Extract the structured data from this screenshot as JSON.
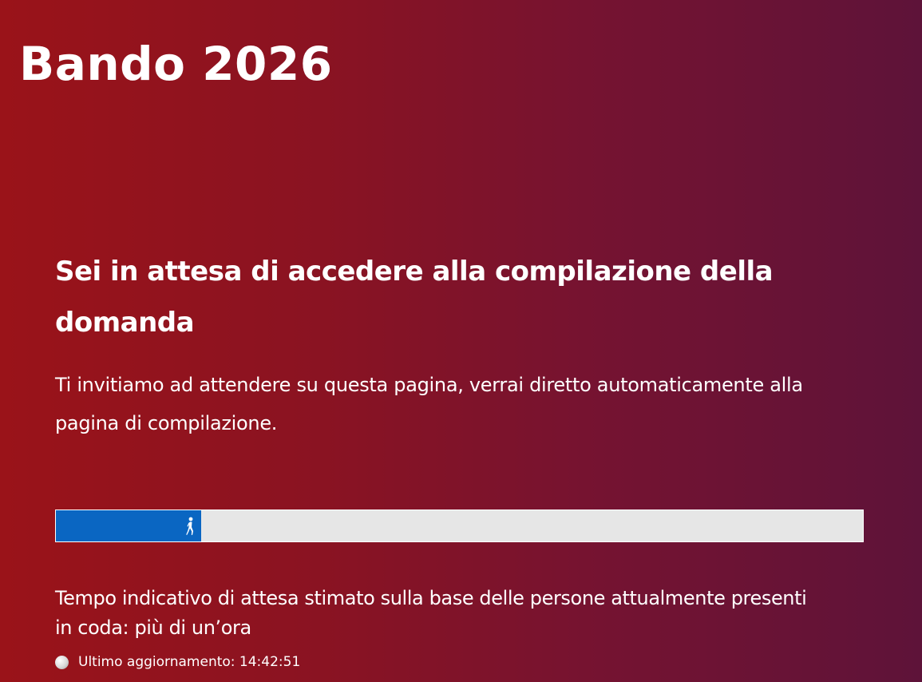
{
  "header": {
    "title": "Bando 2026"
  },
  "queue": {
    "heading": "Sei in attesa di accedere alla compilazione della domanda",
    "instructions": "Ti invitiamo ad attendere su questa pagina, verrai diretto automaticamente alla pagina di compilazione.",
    "progress_fraction": 0.18,
    "progress_icon": "walking-person-icon",
    "wait_estimate": "Tempo indicativo di attesa stimato sulla base delle persone attualmente presenti in coda: più di un’ora",
    "last_update_label": "Ultimo aggiornamento: 14:42:51",
    "status_icon": "status-dot-icon"
  },
  "colors": {
    "background_start": "#9a1319",
    "background_end": "#5e1339",
    "progress_fill": "#0a66c2",
    "progress_track": "#e6e6e6",
    "text": "#ffffff"
  }
}
